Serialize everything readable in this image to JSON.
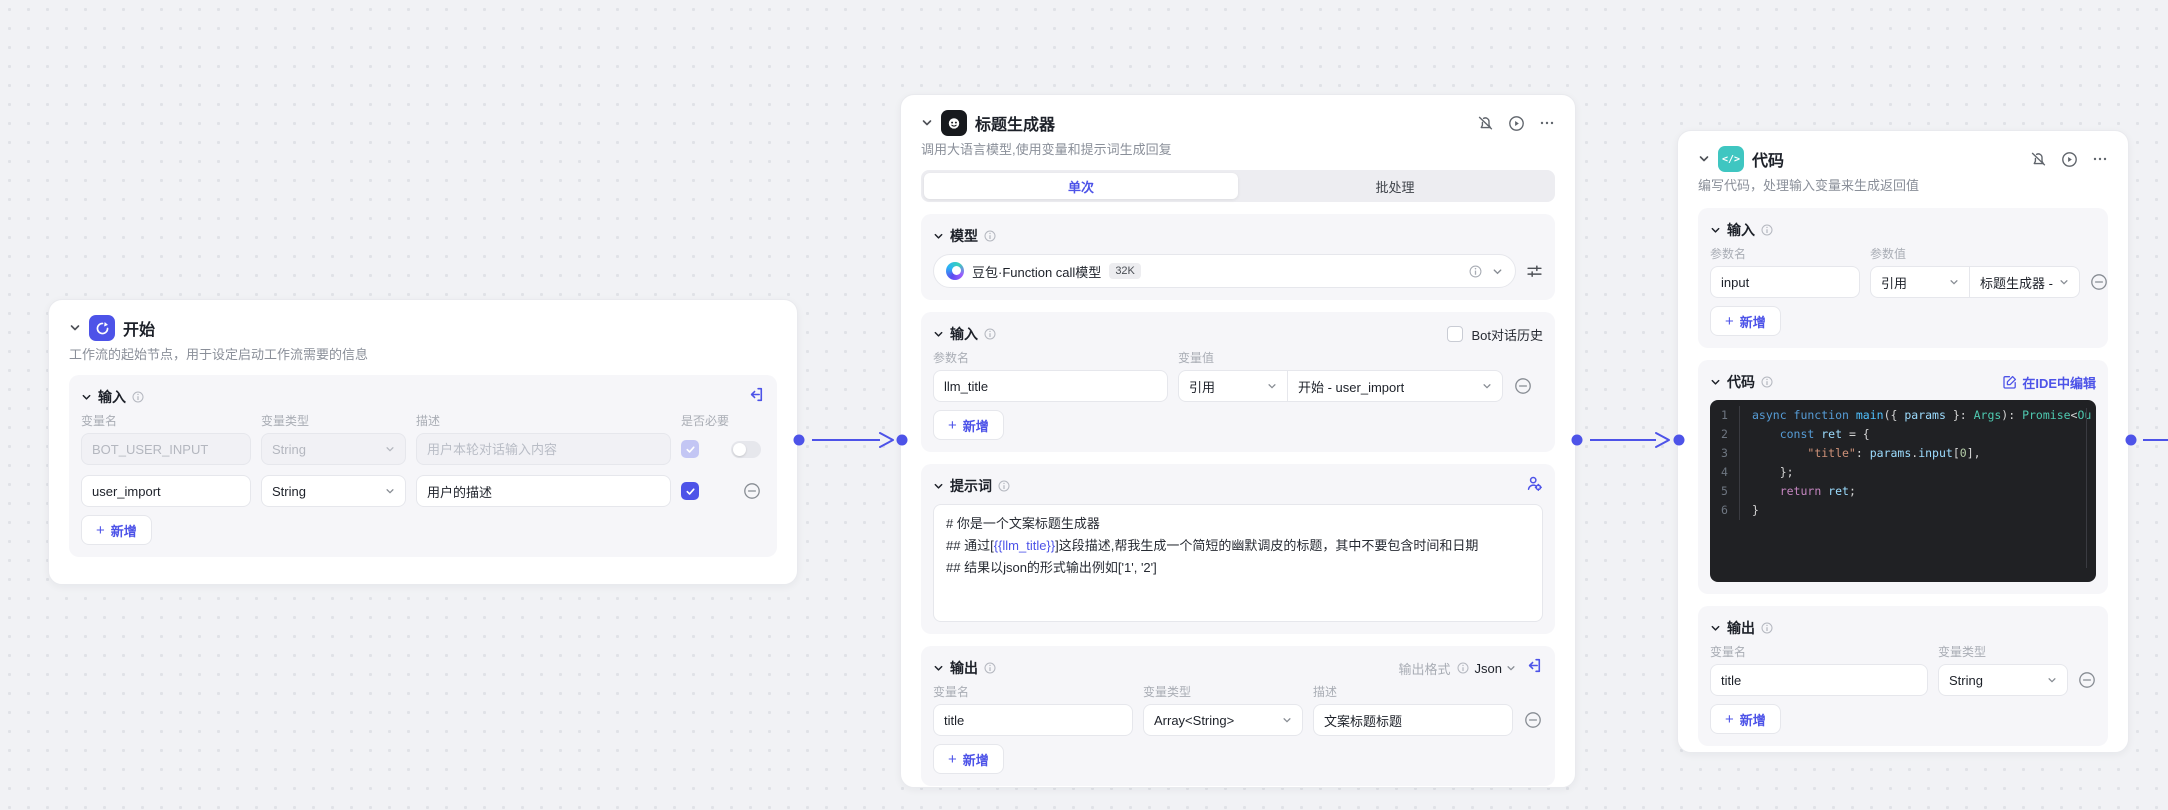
{
  "canvas": {
    "accent": "#4d53e8",
    "background": "#f1f2f5"
  },
  "nodes": {
    "start": {
      "title": "开始",
      "description": "工作流的起始节点，用于设定启动工作流需要的信息",
      "input_section": {
        "title": "输入",
        "columns": [
          "变量名",
          "变量类型",
          "描述",
          "是否必要"
        ],
        "rows": [
          {
            "name": "BOT_USER_INPUT",
            "type": "String",
            "desc_placeholder": "用户本轮对话输入内容",
            "required": true,
            "disabled": true
          },
          {
            "name": "user_import",
            "type": "String",
            "desc": "用户的描述",
            "required": true
          }
        ],
        "add_label": "新增"
      }
    },
    "llm": {
      "title": "标题生成器",
      "description": "调用大语言模型,使用变量和提示词生成回复",
      "tabs": [
        {
          "label": "单次",
          "active": true
        },
        {
          "label": "批处理",
          "active": false
        }
      ],
      "model_section": {
        "title": "模型",
        "model_name": "豆包·Function call模型",
        "model_badge": "32K"
      },
      "input_section": {
        "title": "输入",
        "history_label": "Bot对话历史",
        "columns": [
          "参数名",
          "变量值"
        ],
        "rows": [
          {
            "name": "llm_title",
            "value_kind": "引用",
            "value_ref": "开始 - user_import"
          }
        ],
        "add_label": "新增"
      },
      "prompt_section": {
        "title": "提示词",
        "lines": [
          [
            {
              "t": "# 你是一个文案标题生成器"
            }
          ],
          [
            {
              "t": "## 通过["
            },
            {
              "t": "{{llm_title}}",
              "v": true
            },
            {
              "t": "]这段描述,帮我生成一个简短的幽默调皮的标题，其中不要包含时间和日期"
            }
          ],
          [
            {
              "t": "## 结果以json的形式输出例如['1', '2']"
            }
          ]
        ]
      },
      "output_section": {
        "title": "输出",
        "format_label": "输出格式",
        "format_value": "Json",
        "columns": [
          "变量名",
          "变量类型",
          "描述"
        ],
        "rows": [
          {
            "name": "title",
            "type": "Array<String>",
            "desc": "文案标题标题"
          }
        ],
        "add_label": "新增"
      }
    },
    "code": {
      "title": "代码",
      "description": "编写代码，处理输入变量来生成返回值",
      "input_section": {
        "title": "输入",
        "columns": [
          "参数名",
          "参数值"
        ],
        "rows": [
          {
            "name": "input",
            "value_kind": "引用",
            "value_ref": "标题生成器 -"
          }
        ],
        "add_label": "新增"
      },
      "code_section": {
        "title": "代码",
        "edit_label": "在IDE中编辑",
        "lines": [
          [
            {
              "t": "async function ",
              "c": "kw"
            },
            {
              "t": "main",
              "c": "fn"
            },
            {
              "t": "({ ",
              "c": "pl"
            },
            {
              "t": "params",
              "c": "var"
            },
            {
              "t": " }: ",
              "c": "pl"
            },
            {
              "t": "Args",
              "c": "type"
            },
            {
              "t": "): ",
              "c": "pl"
            },
            {
              "t": "Promise",
              "c": "type"
            },
            {
              "t": "<",
              "c": "pl"
            },
            {
              "t": "Ou",
              "c": "type"
            }
          ],
          [
            {
              "t": "    ",
              "c": "pl"
            },
            {
              "t": "const ",
              "c": "kw"
            },
            {
              "t": "ret",
              "c": "var"
            },
            {
              "t": " = {",
              "c": "pl"
            }
          ],
          [
            {
              "t": "        ",
              "c": "pl"
            },
            {
              "t": "\"title\"",
              "c": "str"
            },
            {
              "t": ": ",
              "c": "pl"
            },
            {
              "t": "params",
              "c": "var"
            },
            {
              "t": ".",
              "c": "pl"
            },
            {
              "t": "input",
              "c": "var"
            },
            {
              "t": "[",
              "c": "pl"
            },
            {
              "t": "0",
              "c": "num"
            },
            {
              "t": "],",
              "c": "pl"
            }
          ],
          [
            {
              "t": "    };",
              "c": "pl"
            }
          ],
          [
            {
              "t": "    ",
              "c": "pl"
            },
            {
              "t": "return ",
              "c": "ctrl"
            },
            {
              "t": "ret",
              "c": "var"
            },
            {
              "t": ";",
              "c": "pl"
            }
          ],
          [
            {
              "t": "}",
              "c": "pl"
            }
          ]
        ]
      },
      "output_section": {
        "title": "输出",
        "columns": [
          "变量名",
          "变量类型"
        ],
        "rows": [
          {
            "name": "title",
            "type": "String"
          }
        ],
        "add_label": "新增"
      }
    }
  }
}
